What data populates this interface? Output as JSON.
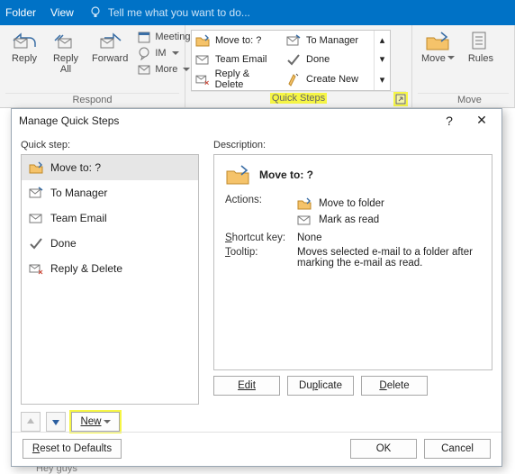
{
  "tabs": {
    "folder": "Folder",
    "view": "View",
    "tell": "Tell me what you want to do..."
  },
  "ribbon": {
    "respond": {
      "label": "Respond",
      "reply": "Reply",
      "reply_all": "Reply\nAll",
      "forward": "Forward",
      "meeting": "Meeting",
      "im": "IM",
      "more": "More"
    },
    "quicksteps": {
      "label": "Quick Steps",
      "items": [
        "Move to: ?",
        "Team Email",
        "Reply & Delete",
        "To Manager",
        "Done",
        "Create New"
      ]
    },
    "move": {
      "label": "Move",
      "move": "Move",
      "rules": "Rules"
    }
  },
  "dialog": {
    "title": "Manage Quick Steps",
    "help": "?",
    "close": "✕",
    "left_label": "Quick step:",
    "right_label": "Description:",
    "items": [
      {
        "icon": "folder-move",
        "label": "Move to: ?"
      },
      {
        "icon": "to-manager",
        "label": "To Manager"
      },
      {
        "icon": "team-email",
        "label": "Team Email"
      },
      {
        "icon": "done",
        "label": "Done"
      },
      {
        "icon": "reply-delete",
        "label": "Reply & Delete"
      }
    ],
    "selected": {
      "name": "Move to: ?",
      "actions_label": "Actions:",
      "actions": [
        "Move to folder",
        "Mark as read"
      ],
      "shortcut_label": "Shortcut key:",
      "shortcut": "None",
      "tooltip_label": "Tooltip:",
      "tooltip": "Moves selected e-mail to a folder after marking the e-mail as read."
    },
    "buttons": {
      "edit": "Edit",
      "duplicate": "Duplicate",
      "delete": "Delete",
      "new": "New",
      "reset": "Reset to Defaults",
      "ok": "OK",
      "cancel": "Cancel"
    }
  },
  "behind": {
    "hey": "Hey guys"
  }
}
